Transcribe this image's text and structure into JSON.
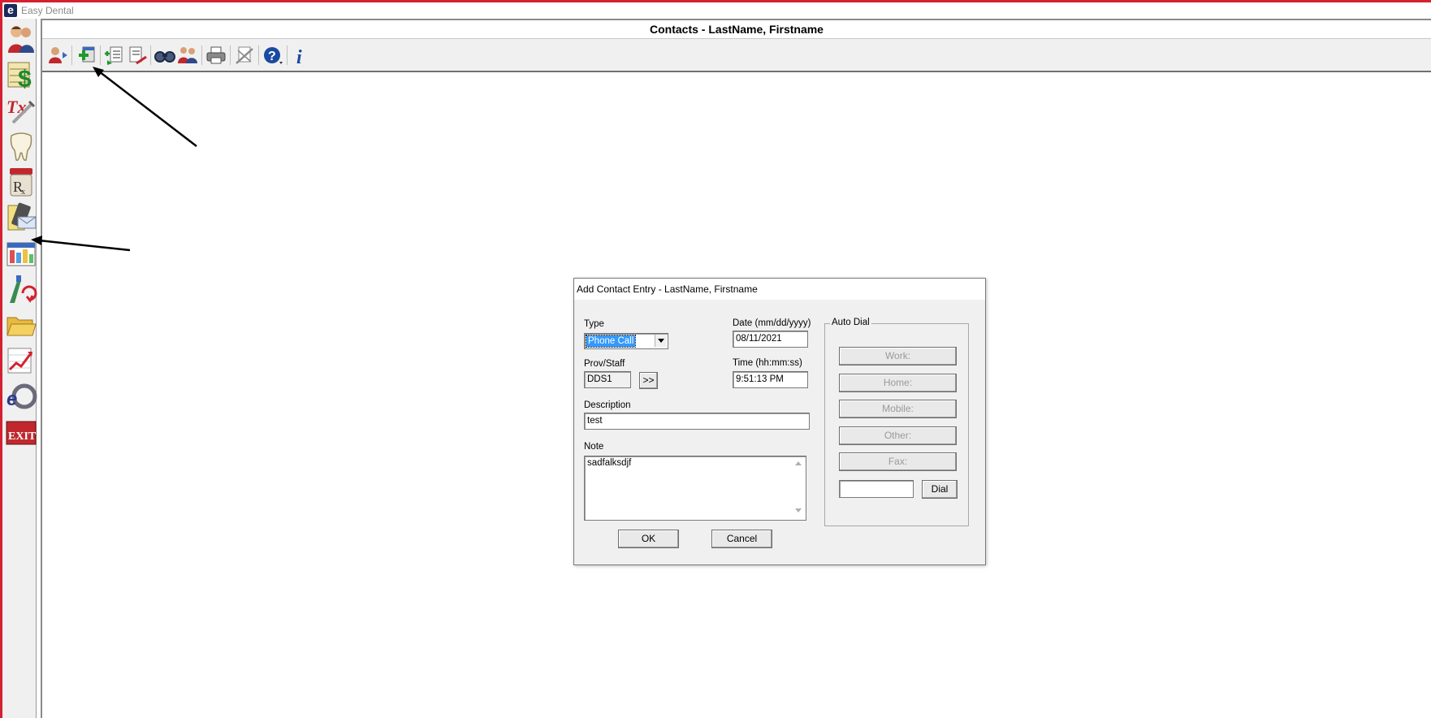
{
  "app": {
    "title": "Easy Dental",
    "logo_letter": "e"
  },
  "sidebar": {
    "items": [
      {
        "name": "family-file",
        "icon": "patients-icon"
      },
      {
        "name": "ledger",
        "icon": "dollar-ledger-icon"
      },
      {
        "name": "treatment-plan",
        "icon": "tx-icon"
      },
      {
        "name": "chart",
        "icon": "tooth-icon"
      },
      {
        "name": "prescriptions",
        "icon": "rx-icon"
      },
      {
        "name": "contacts",
        "icon": "contact-envelope-icon"
      },
      {
        "name": "appointment-book",
        "icon": "schedule-icon"
      },
      {
        "name": "continuing-care",
        "icon": "recall-icon"
      },
      {
        "name": "document-center",
        "icon": "folder-icon"
      },
      {
        "name": "analysis",
        "icon": "chart-arrow-icon"
      },
      {
        "name": "easy-dental-online",
        "icon": "ed-logo-icon"
      },
      {
        "name": "exit",
        "icon": "exit-icon",
        "label": "EXIT"
      }
    ]
  },
  "contacts_window": {
    "title": "Contacts - LastName, Firstname",
    "toolbar": [
      "select-patient-icon",
      "add-contact-icon",
      "add-entry-icon",
      "edit-entry-icon",
      "search-icon",
      "family-icon",
      "print-icon",
      "delete-icon",
      "help-icon",
      "info-icon"
    ],
    "info_glyph": "i",
    "help_glyph": "?"
  },
  "dialog": {
    "title": "Add Contact Entry - LastName, Firstname",
    "type_label": "Type",
    "type_value": "Phone Call",
    "date_label": "Date (mm/dd/yyyy)",
    "date_value": "08/11/2021",
    "prov_label": "Prov/Staff",
    "prov_value": "DDS1",
    "prov_button": ">>",
    "time_label": "Time (hh:mm:ss)",
    "time_value": "9:51:13 PM",
    "description_label": "Description",
    "description_value": "test",
    "note_label": "Note",
    "note_value": "sadfalksdjf",
    "ok_label": "OK",
    "cancel_label": "Cancel",
    "auto_dial": {
      "legend": "Auto Dial",
      "work_label": "Work:",
      "home_label": "Home:",
      "mobile_label": "Mobile:",
      "other_label": "Other:",
      "fax_label": "Fax:",
      "dial_value": "",
      "dial_label": "Dial"
    }
  },
  "colors": {
    "accent": "#d42030",
    "selection": "#3399ff"
  }
}
